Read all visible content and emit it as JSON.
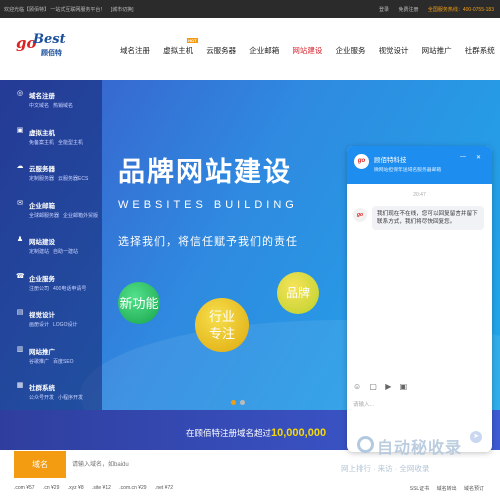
{
  "topbar": {
    "welcome": "欢迎光临【顾佰特】 一站式互联网服务平台！",
    "city": "[城市切换]",
    "login": "登录",
    "register": "免费注册",
    "phone": "全国服务热线：400-0755-183"
  },
  "logo": {
    "go": "go",
    "best": "Best",
    "cn": "顾佰特"
  },
  "nav": {
    "items": [
      "域名注册",
      "虚拟主机",
      "云服务器",
      "企业邮箱",
      "网站建设",
      "企业服务",
      "视觉设计",
      "网站推广",
      "社群系统"
    ],
    "hot_badge": "HOT",
    "current": "网站建设"
  },
  "sidebar": {
    "items": [
      {
        "icon": "globe-icon",
        "glyph": "◎",
        "title": "域名注册",
        "subs": [
          "中文域名",
          "热销域名"
        ]
      },
      {
        "icon": "server-icon",
        "glyph": "▣",
        "title": "虚拟主机",
        "subs": [
          "免备案主机",
          "全能型主机"
        ]
      },
      {
        "icon": "cloud-icon",
        "glyph": "☁",
        "title": "云服务器",
        "subs": [
          "定制服务器",
          "云服务器ECS"
        ]
      },
      {
        "icon": "mail-icon",
        "glyph": "✉",
        "title": "企业邮箱",
        "subs": [
          "全球邮服务器",
          "企业邮箱外贸版"
        ]
      },
      {
        "icon": "user-icon",
        "glyph": "♟",
        "title": "网站建设",
        "subs": [
          "定制建站",
          "自助一建站"
        ]
      },
      {
        "icon": "phone-icon",
        "glyph": "☎",
        "title": "企业服务",
        "subs": [
          "注册公司",
          "400电话申请号"
        ]
      },
      {
        "icon": "palette-icon",
        "glyph": "▤",
        "title": "视觉设计",
        "subs": [
          "画册设计",
          "LOGO设计"
        ]
      },
      {
        "icon": "chart-icon",
        "glyph": "▥",
        "title": "网站推广",
        "subs": [
          "谷歌推广",
          "百度SEO"
        ]
      },
      {
        "icon": "group-icon",
        "glyph": "▦",
        "title": "社群系统",
        "subs": [
          "公众号开发",
          "小程序开发"
        ]
      }
    ]
  },
  "hero": {
    "title": "品牌网站建设",
    "subtitle_en": "WEBSITES  BUILDING",
    "slogan": "选择我们，将信任赋予我们的责任",
    "bubbles": [
      "新功能",
      "行业\n专注",
      "品牌"
    ]
  },
  "promo": {
    "text": "在顾佰特注册域名超过",
    "number": "10,000,000"
  },
  "search": {
    "tag": "域名",
    "placeholder": "请输入域名，如baidu"
  },
  "tlds": [
    ".com ¥57",
    ".cn ¥29",
    ".xyz ¥8",
    ".site ¥12",
    ".com.cn ¥29",
    ".net ¥72"
  ],
  "rlinks": [
    "SSL证书",
    "域名转出",
    "域名预订"
  ],
  "chat": {
    "name": "顾佰特科技",
    "desc": "微网站担保年送域名服务器邮箱",
    "min": "—",
    "close": "✕",
    "time": "20:47",
    "avatar": "go",
    "message": "我们现在不在线，您可以回复留言并留下联系方式，我们将尽快回复您。",
    "tools": [
      "☺",
      "▢",
      "▶",
      "▣"
    ],
    "placeholder": "请输入...",
    "send": "➤"
  },
  "watermark": {
    "big": "自动秘收录",
    "small": "网上排行 · 来访 · 全网收录"
  }
}
